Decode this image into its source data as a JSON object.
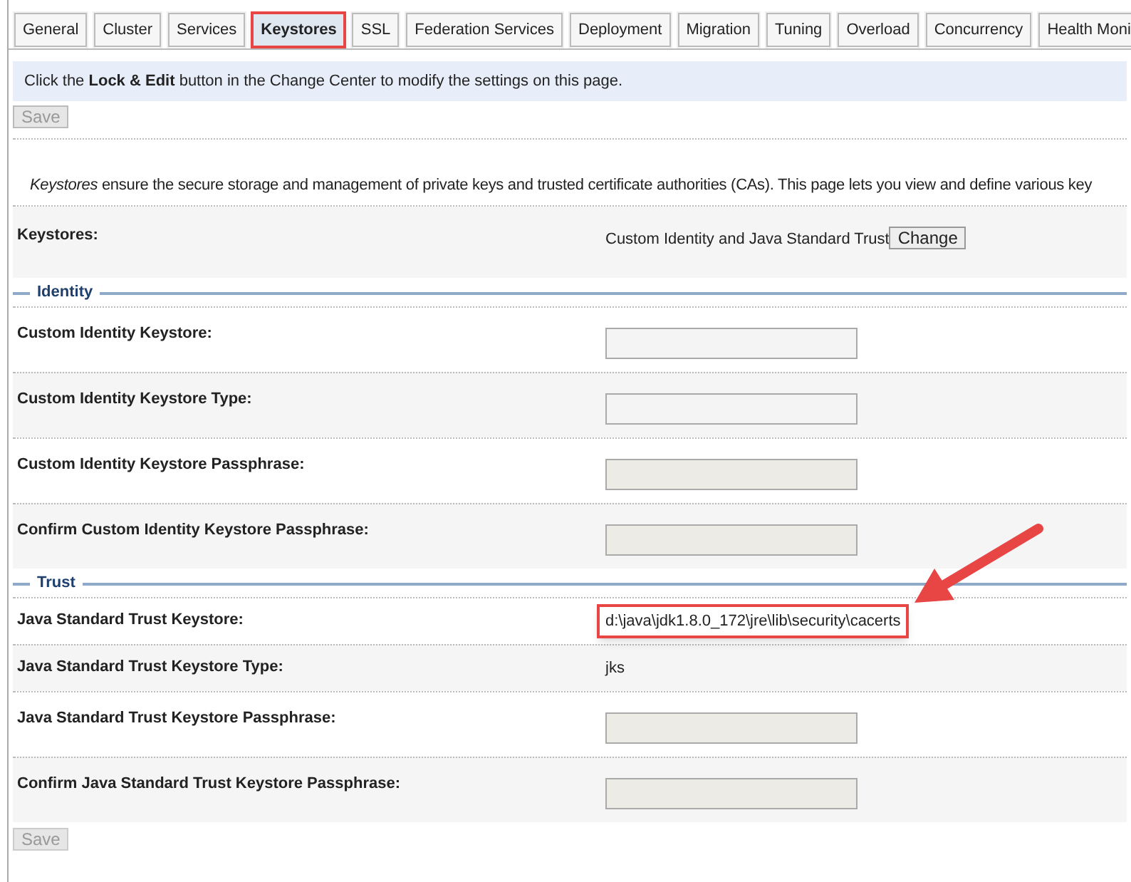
{
  "tabs": [
    {
      "label": "General",
      "selected": false,
      "highlighted": false
    },
    {
      "label": "Cluster",
      "selected": false,
      "highlighted": false
    },
    {
      "label": "Services",
      "selected": false,
      "highlighted": false
    },
    {
      "label": "Keystores",
      "selected": true,
      "highlighted": true
    },
    {
      "label": "SSL",
      "selected": false,
      "highlighted": false
    },
    {
      "label": "Federation Services",
      "selected": false,
      "highlighted": false
    },
    {
      "label": "Deployment",
      "selected": false,
      "highlighted": false
    },
    {
      "label": "Migration",
      "selected": false,
      "highlighted": false
    },
    {
      "label": "Tuning",
      "selected": false,
      "highlighted": false
    },
    {
      "label": "Overload",
      "selected": false,
      "highlighted": false
    },
    {
      "label": "Concurrency",
      "selected": false,
      "highlighted": false
    },
    {
      "label": "Health Moni",
      "selected": false,
      "highlighted": false
    }
  ],
  "info_message": "Click the **Lock & Edit** button in the Change Center to modify the settings on this page.",
  "save_button": {
    "label": "Save",
    "disabled": true
  },
  "description": "*Keystores* ensure the secure storage and management of private keys and trusted certificate authorities (CAs). This page lets you view and define various key",
  "keystores_row": {
    "label": "Keystores:",
    "value": "Custom Identity and Java Standard Trust",
    "button": "Change"
  },
  "sections": [
    {
      "title": "Identity",
      "rows": [
        {
          "label": "Custom Identity Keystore:",
          "kind": "text",
          "highlighted": false
        },
        {
          "label": "Custom Identity Keystore Type:",
          "kind": "text",
          "highlighted": false
        },
        {
          "label": "Custom Identity Keystore Passphrase:",
          "kind": "password",
          "highlighted": false
        },
        {
          "label": "Confirm Custom Identity Keystore Passphrase:",
          "kind": "password",
          "highlighted": false
        }
      ]
    },
    {
      "title": "Trust",
      "rows": [
        {
          "label": "Java Standard Trust Keystore:",
          "kind": "value",
          "value": "d:\\java\\jdk1.8.0_172\\jre\\lib\\security\\cacerts",
          "highlighted": true
        },
        {
          "label": "Java Standard Trust Keystore Type:",
          "kind": "value",
          "value": "jks",
          "highlighted": false
        },
        {
          "label": "Java Standard Trust Keystore Passphrase:",
          "kind": "password",
          "highlighted": false
        },
        {
          "label": "Confirm Java Standard Trust Keystore Passphrase:",
          "kind": "password",
          "highlighted": false
        }
      ]
    }
  ],
  "bottom_save_button": {
    "label": "Save",
    "disabled": true
  }
}
